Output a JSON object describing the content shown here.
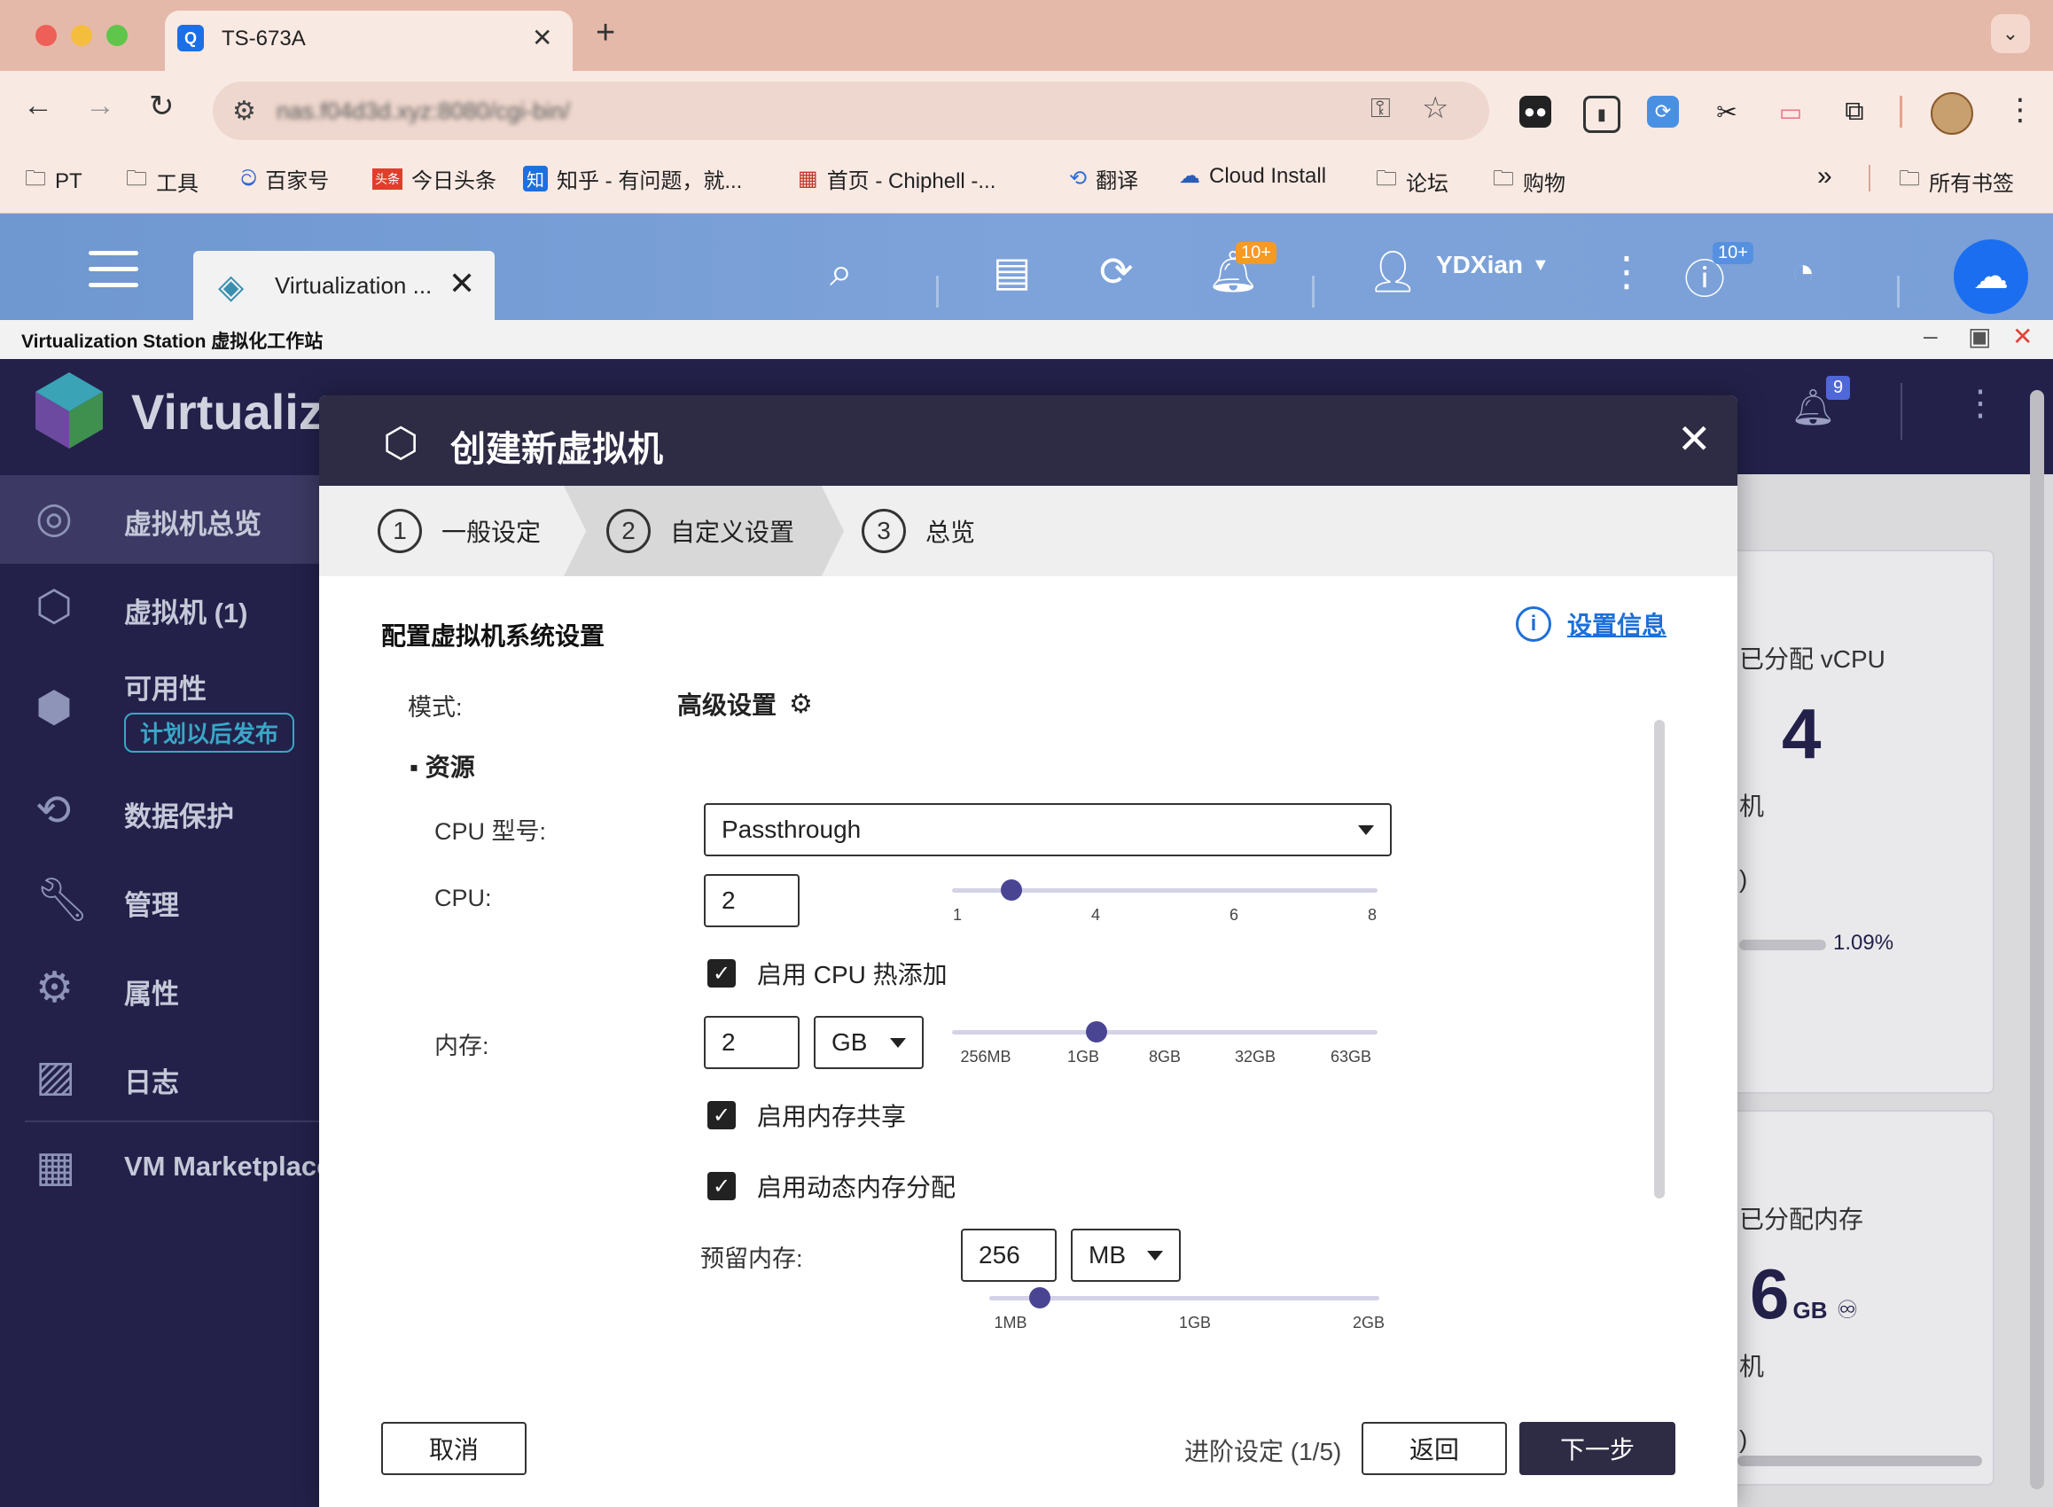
{
  "browser": {
    "tab_title": "TS-673A",
    "tab_favicon": "Q",
    "url": "nas.f04d3d.xyz:8080/cgi-bin/",
    "bookmarks": [
      {
        "label": "PT",
        "icon": "folder-icon"
      },
      {
        "label": "工具",
        "icon": "folder-icon"
      },
      {
        "label": "百家号",
        "icon": "baijiahao-icon"
      },
      {
        "label": "今日头条",
        "icon": "toutiao-icon"
      },
      {
        "label": "知乎 - 有问题，就...",
        "icon": "zhihu-icon"
      },
      {
        "label": "首页 - Chiphell -...",
        "icon": "chiphell-icon"
      },
      {
        "label": "翻译",
        "icon": "translate-icon"
      },
      {
        "label": "Cloud Install",
        "icon": "cloud-icon"
      },
      {
        "label": "论坛",
        "icon": "folder-icon"
      },
      {
        "label": "购物",
        "icon": "folder-icon"
      }
    ],
    "bookmarks_overflow": "»",
    "all_bookmarks": "所有书签",
    "toutiao_badge": "头条",
    "zhihu_badge": "知"
  },
  "qts": {
    "tab_title": "Virtualization ...",
    "user": "YDXian",
    "notification_badge": "10+",
    "info_badge": "10+"
  },
  "station": {
    "title": "Virtualization Station 虚拟化工作站"
  },
  "app": {
    "name": "Virtualiz",
    "bell_badge": "9",
    "sidebar": [
      {
        "label": "虚拟机总览",
        "icon": "dashboard-icon"
      },
      {
        "label": "虚拟机 (1)",
        "icon": "vm-icon"
      },
      {
        "label": "可用性",
        "icon": "availability-icon"
      },
      {
        "label": "数据保护",
        "icon": "data-protection-icon"
      },
      {
        "label": "管理",
        "icon": "wrench-icon"
      },
      {
        "label": "属性",
        "icon": "gear-icon"
      },
      {
        "label": "日志",
        "icon": "log-icon"
      },
      {
        "label": "VM Marketplace",
        "icon": "marketplace-icon"
      }
    ],
    "availability_badge": "计划以后发布",
    "cards": {
      "vcpu_label": "已分配 vCPU",
      "vcpu_value": "4",
      "vcpu_sub": "机",
      "vcpu_paren": ")",
      "vcpu_percent": "1.09%",
      "mem_label": "已分配内存",
      "mem_value": "6",
      "mem_unit": "GB",
      "mem_sub": "机",
      "mem_paren": ")"
    }
  },
  "modal": {
    "title": "创建新虚拟机",
    "steps": [
      {
        "num": "1",
        "label": "一般设定"
      },
      {
        "num": "2",
        "label": "自定义设置"
      },
      {
        "num": "3",
        "label": "总览"
      }
    ],
    "section_title": "配置虚拟机系统设置",
    "info_link": "设置信息",
    "mode_label": "模式:",
    "mode_value": "高级设置",
    "resources_label": "▪ 资源",
    "cpu_model_label": "CPU 型号:",
    "cpu_model_value": "Passthrough",
    "cpu_label": "CPU:",
    "cpu_value": "2",
    "cpu_ticks": [
      "1",
      "4",
      "6",
      "8"
    ],
    "cpu_slider_fraction": 0.14,
    "cpu_hotplug_label": "启用 CPU 热添加",
    "memory_label": "内存:",
    "memory_value": "2",
    "memory_unit": "GB",
    "memory_ticks": [
      "256MB",
      "1GB",
      "8GB",
      "32GB",
      "63GB"
    ],
    "memory_slider_fraction": 0.34,
    "memory_share_label": "启用内存共享",
    "dynamic_memory_label": "启用动态内存分配",
    "reserved_label": "预留内存:",
    "reserved_value": "256",
    "reserved_unit": "MB",
    "reserved_ticks": [
      "1MB",
      "1GB",
      "2GB"
    ],
    "reserved_slider_fraction": 0.13,
    "cancel": "取消",
    "progress": "进阶设定 (1/5)",
    "back": "返回",
    "next": "下一步"
  }
}
